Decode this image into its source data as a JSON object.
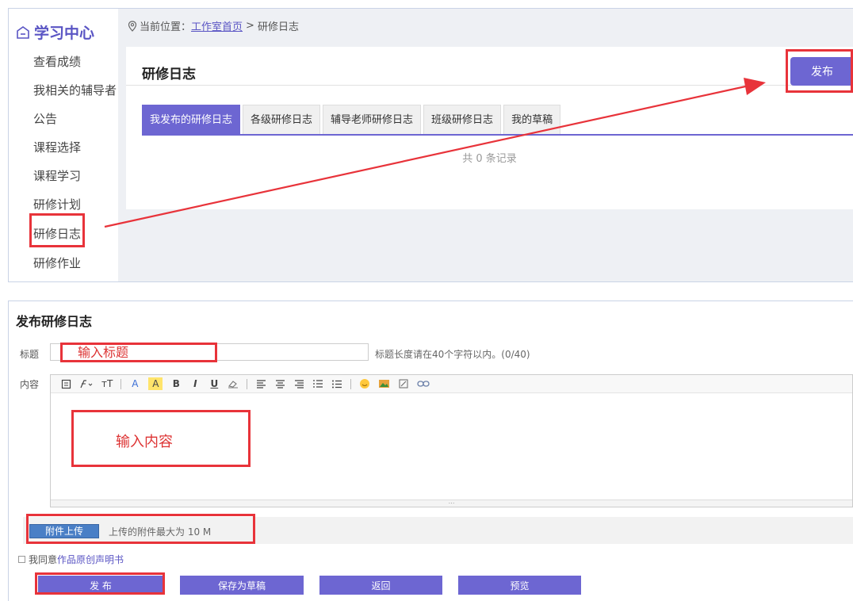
{
  "sidebar": {
    "brand": "学习中心",
    "items": [
      "查看成绩",
      "我相关的辅导者",
      "公告",
      "课程选择",
      "课程学习",
      "研修计划",
      "研修日志",
      "研修作业"
    ]
  },
  "breadcrumb": {
    "prefix": "当前位置：",
    "home": "工作室首页",
    "separator": ">",
    "current": "研修日志"
  },
  "journal": {
    "title": "研修日志",
    "publish_label": "发布",
    "tabs": [
      "我发布的研修日志",
      "各级研修日志",
      "辅导老师研修日志",
      "班级研修日志",
      "我的草稿"
    ],
    "records": "共 0 条记录"
  },
  "form": {
    "heading": "发布研修日志",
    "title_label": "标题",
    "title_placeholder": "输入标题",
    "title_hint": "标题长度请在40个字符以内。(0/40)",
    "content_label": "内容",
    "content_placeholder": "输入内容",
    "upload_label": "附件上传",
    "upload_note": "上传的附件最大为 10 M",
    "agree_prefix": "我同意",
    "agree_link": "作品原创声明书",
    "buttons": {
      "publish": "发 布",
      "save_draft": "保存为草稿",
      "back": "返回",
      "preview": "预览"
    }
  },
  "toolbar": {
    "font_size": "тT",
    "text_color": "A",
    "bg_color": "A",
    "bold": "B",
    "italic": "I",
    "underline": "U"
  },
  "colors": {
    "accent": "#6d66d2",
    "highlight": "#e8333a",
    "upload": "#4a7fc6"
  }
}
